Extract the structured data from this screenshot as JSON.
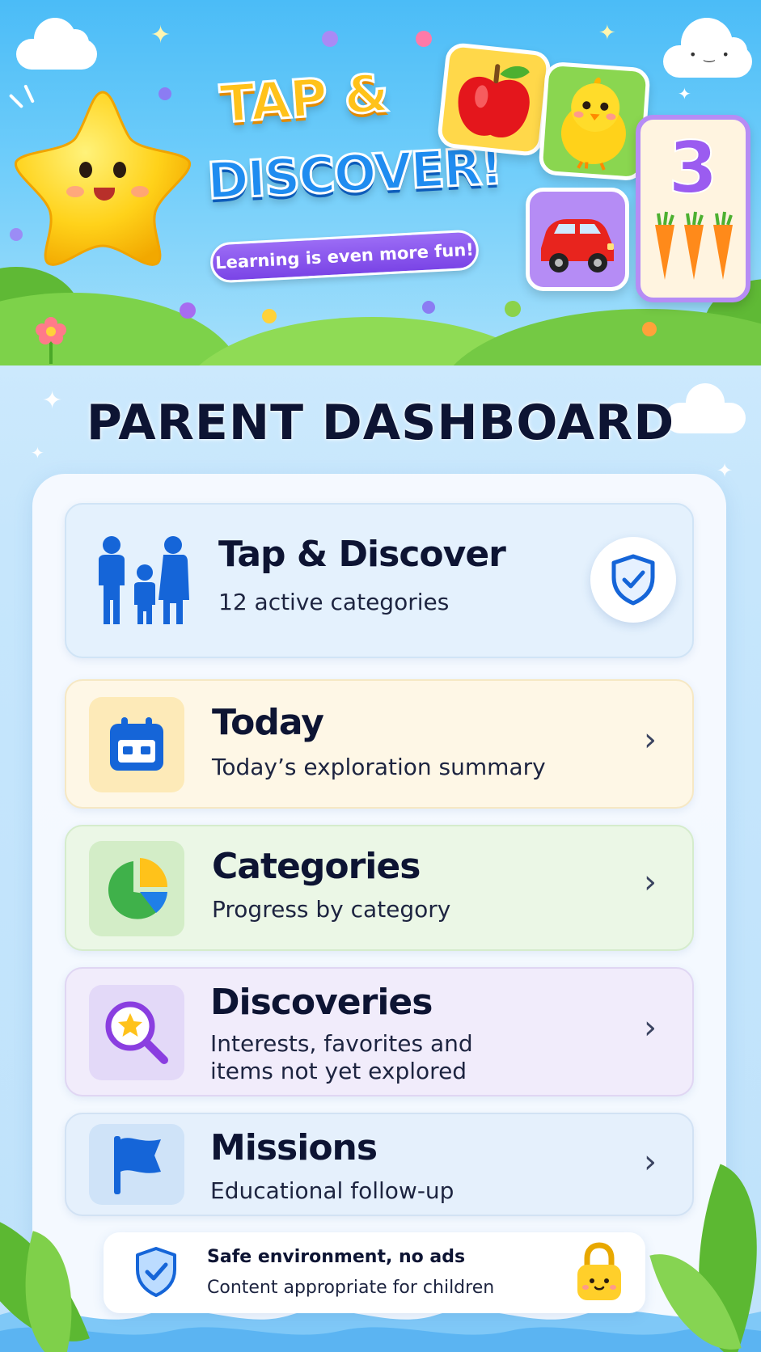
{
  "hero": {
    "title_line1": "TAP &",
    "title_line2": "DISCOVER!",
    "tagline": "Learning is even more fun!",
    "number_tile": "3"
  },
  "dashboard": {
    "title": "PARENT DASHBOARD"
  },
  "summary_card": {
    "title": "Tap & Discover",
    "subtitle": "12 active categories",
    "icon": "family-icon",
    "action_icon": "shield-check-icon"
  },
  "menu": [
    {
      "title": "Today",
      "subtitle": "Today’s exploration summary",
      "icon": "calendar-icon"
    },
    {
      "title": "Categories",
      "subtitle": "Progress by category",
      "icon": "pie-chart-icon"
    },
    {
      "title": "Discoveries",
      "subtitle_line1": "Interests, favorites and",
      "subtitle_line2": "items not yet explored",
      "icon": "star-search-icon"
    },
    {
      "title": "Missions",
      "subtitle": "Educational follow-up",
      "icon": "flag-icon"
    }
  ],
  "safe_banner": {
    "title": "Safe environment, no ads",
    "subtitle": "Content appropriate for children",
    "icon": "shield-check-icon",
    "badge_icon": "lock-icon"
  },
  "colors": {
    "accent_blue": "#1565d8",
    "today_bg": "#fef7e6",
    "categories_bg": "#ebf7e6",
    "discoveries_bg": "#f1ecfb",
    "missions_bg": "#e5f0fc",
    "tagline_purple": "#7a44e6"
  }
}
